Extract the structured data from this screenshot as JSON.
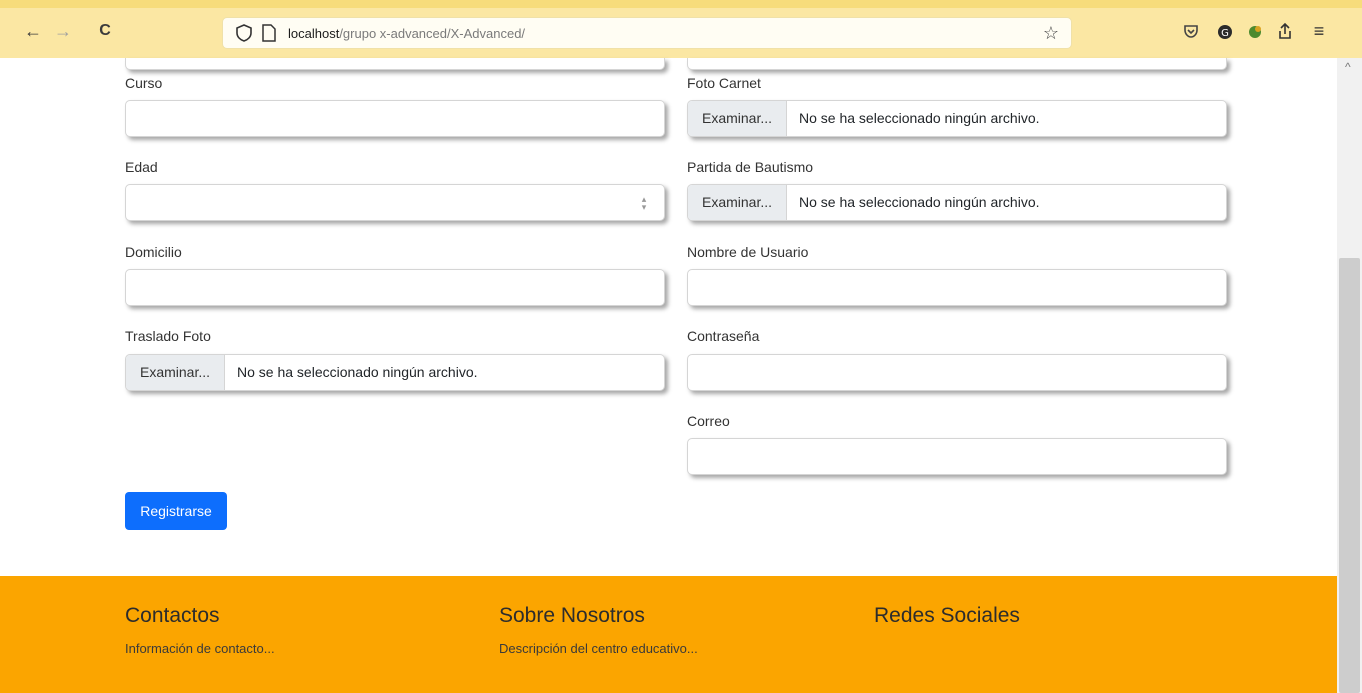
{
  "browser": {
    "back_icon": "←",
    "forward_icon": "→",
    "reload_icon": "C",
    "url_host": "localhost",
    "url_path": "/grupo x-advanced/X-Advanced/",
    "bookmark_icon": "☆",
    "menu_icon": "≡"
  },
  "form": {
    "curso_label": "Curso",
    "edad_label": "Edad",
    "domicilio_label": "Domicilio",
    "traslado_label": "Traslado Foto",
    "foto_carnet_label": "Foto Carnet",
    "partida_label": "Partida de Bautismo",
    "usuario_label": "Nombre de Usuario",
    "contrasena_label": "Contraseña",
    "correo_label": "Correo",
    "browse_label": "Examinar...",
    "no_file_text": "No se ha seleccionado ningún archivo.",
    "submit_label": "Registrarse"
  },
  "footer": {
    "contactos_title": "Contactos",
    "contactos_text": "Información de contacto...",
    "nosotros_title": "Sobre Nosotros",
    "nosotros_text": "Descripción del centro educativo...",
    "redes_title": "Redes Sociales"
  }
}
